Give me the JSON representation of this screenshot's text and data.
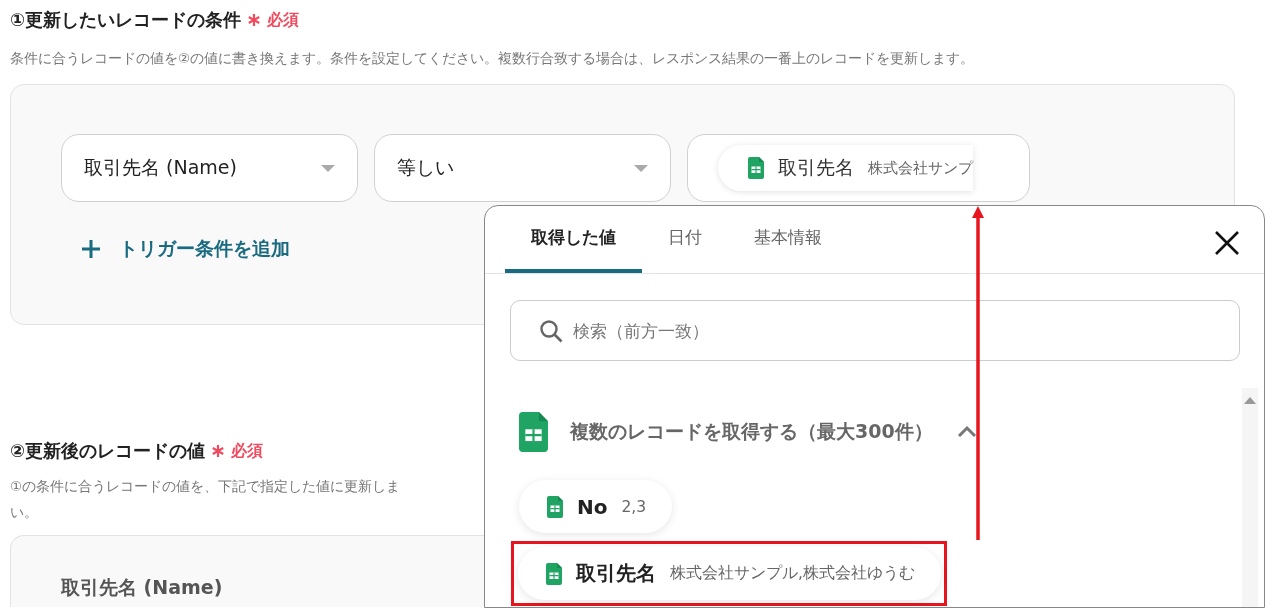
{
  "section_1": {
    "title": "①更新したいレコードの条件",
    "required": "必須",
    "description": "条件に合うレコードの値を②の値に書き換えます。条件を設定してください。複数行合致する場合は、レスポンス結果の一番上のレコードを更新します。",
    "condition": {
      "field": "取引先名 (Name)",
      "operator": "等しい",
      "value": {
        "name": "取引先名",
        "preview": "株式会社サンプ"
      }
    },
    "add_button": "トリガー条件を追加"
  },
  "section_2": {
    "title": "②更新後のレコードの値",
    "required": "必須",
    "description_lines": [
      "①の条件に合うレコードの値を、下記で指定した値に更新しま",
      "い。"
    ],
    "field_label": "取引先名 (Name)"
  },
  "picker": {
    "tabs": [
      {
        "label": "取得した値",
        "selected": true
      },
      {
        "label": "日付",
        "selected": false
      },
      {
        "label": "基本情報",
        "selected": false
      }
    ],
    "search": {
      "placeholder": "検索（前方一致）"
    },
    "group": {
      "title": "複数のレコードを取得する（最大300件）",
      "expanded": true,
      "items": [
        {
          "name": "No",
          "value": "2,3",
          "highlighted": false
        },
        {
          "name": "取引先名",
          "value": "株式会社サンプル,株式会社ゆうむ",
          "highlighted": true
        }
      ]
    }
  }
}
